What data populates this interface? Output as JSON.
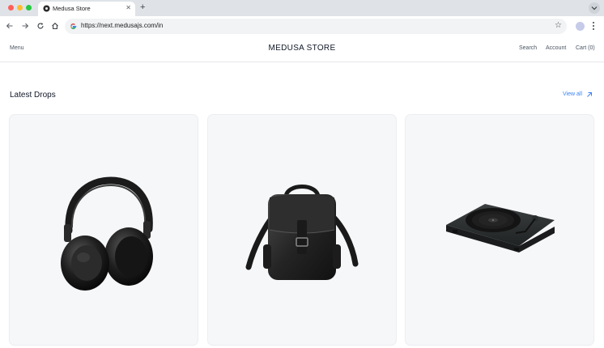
{
  "browser": {
    "tab_title": "Medusa Store",
    "new_tab_label": "+",
    "url": "https://next.medusajs.com/in"
  },
  "header": {
    "menu_label": "Menu",
    "brand": "MEDUSA STORE",
    "search_label": "Search",
    "account_label": "Account",
    "cart_label": "Cart (0)"
  },
  "section": {
    "title": "Latest Drops",
    "view_all_label": "View all"
  },
  "products": [
    {
      "image": "headphones"
    },
    {
      "image": "backpack"
    },
    {
      "image": "turntable"
    }
  ],
  "colors": {
    "chrome": "#dfe3e8",
    "card_bg": "#f6f7f9",
    "link": "#3b82f6"
  }
}
